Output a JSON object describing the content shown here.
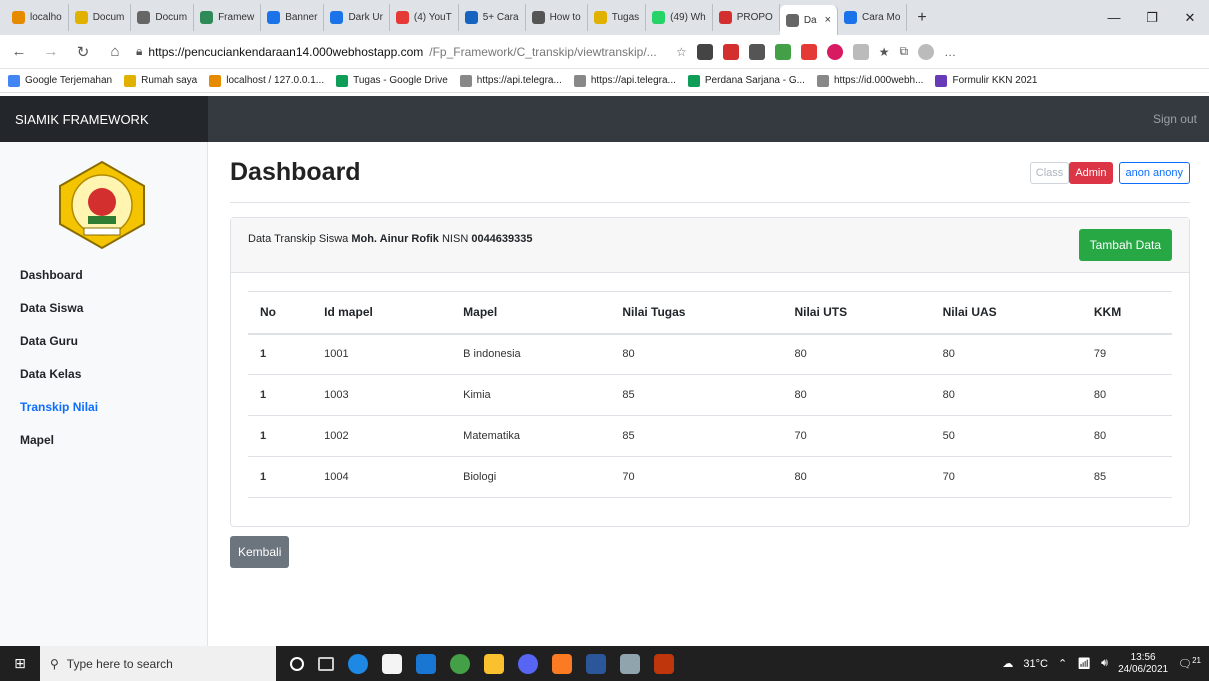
{
  "browser": {
    "tabs": [
      {
        "label": "localho",
        "color": "#e68a00"
      },
      {
        "label": "Docum",
        "color": "#e0b100"
      },
      {
        "label": "Docum",
        "color": "#666"
      },
      {
        "label": "Framew",
        "color": "#2e8b57"
      },
      {
        "label": "Banner",
        "color": "#1a73e8"
      },
      {
        "label": "Dark Ur",
        "color": "#1a73e8"
      },
      {
        "label": "(4) YouT",
        "color": "#e53935"
      },
      {
        "label": "5+ Cara",
        "color": "#1565c0"
      },
      {
        "label": "How to",
        "color": "#555"
      },
      {
        "label": "Tugas",
        "color": "#e0b100"
      },
      {
        "label": "(49) Wh",
        "color": "#25d366"
      },
      {
        "label": "PROPO",
        "color": "#d32f2f"
      },
      {
        "label": "Da",
        "color": "#666"
      },
      {
        "label": "Cara Mo",
        "color": "#1a73e8"
      }
    ],
    "active_tab_index": 12,
    "close_tab": "×",
    "new_tab": "+",
    "url_main": "https://pencuciankendaraan14.000webhostapp.com",
    "url_rest": "/Fp_Framework/C_transkip/viewtranskip/...",
    "bookmarks": [
      {
        "label": "Google Terjemahan",
        "color": "#4285f4"
      },
      {
        "label": "Rumah saya",
        "color": "#e0b100"
      },
      {
        "label": "localhost / 127.0.0.1...",
        "color": "#e68a00"
      },
      {
        "label": "Tugas - Google Drive",
        "color": "#0f9d58"
      },
      {
        "label": "https://api.telegra...",
        "color": "#888"
      },
      {
        "label": "https://api.telegra...",
        "color": "#888"
      },
      {
        "label": "Perdana Sarjana - G...",
        "color": "#0f9d58"
      },
      {
        "label": "https://id.000webh...",
        "color": "#888"
      },
      {
        "label": "Formulir KKN 2021",
        "color": "#673ab7"
      }
    ]
  },
  "app": {
    "brand": "SIAMIK FRAMEWORK",
    "signout": "Sign out",
    "menu": [
      "Dashboard",
      "Data Siswa",
      "Data Guru",
      "Data Kelas",
      "Transkip Nilai",
      "Mapel"
    ],
    "active_menu": 4
  },
  "main": {
    "title": "Dashboard",
    "badge_class": "Class",
    "badge_admin": "Admin",
    "badge_user": "anon anony",
    "card_prefix": "Data Transkip Siswa ",
    "student_name": "Moh. Ainur Rofik",
    "nisn_label": " NISN ",
    "nisn": "0044639335",
    "add_button": "Tambah Data",
    "back_button": "Kembali",
    "columns": [
      "No",
      "Id mapel",
      "Mapel",
      "Nilai Tugas",
      "Nilai UTS",
      "Nilai UAS",
      "KKM"
    ],
    "rows": [
      [
        "1",
        "1001",
        "B indonesia",
        "80",
        "80",
        "80",
        "79"
      ],
      [
        "1",
        "1003",
        "Kimia",
        "85",
        "80",
        "80",
        "80"
      ],
      [
        "1",
        "1002",
        "Matematika",
        "85",
        "70",
        "50",
        "80"
      ],
      [
        "1",
        "1004",
        "Biologi",
        "70",
        "80",
        "70",
        "85"
      ]
    ]
  },
  "taskbar": {
    "search_placeholder": "Type here to search",
    "weather": "31°C",
    "time": "13:56",
    "date": "24/06/2021",
    "notifications": "21"
  }
}
